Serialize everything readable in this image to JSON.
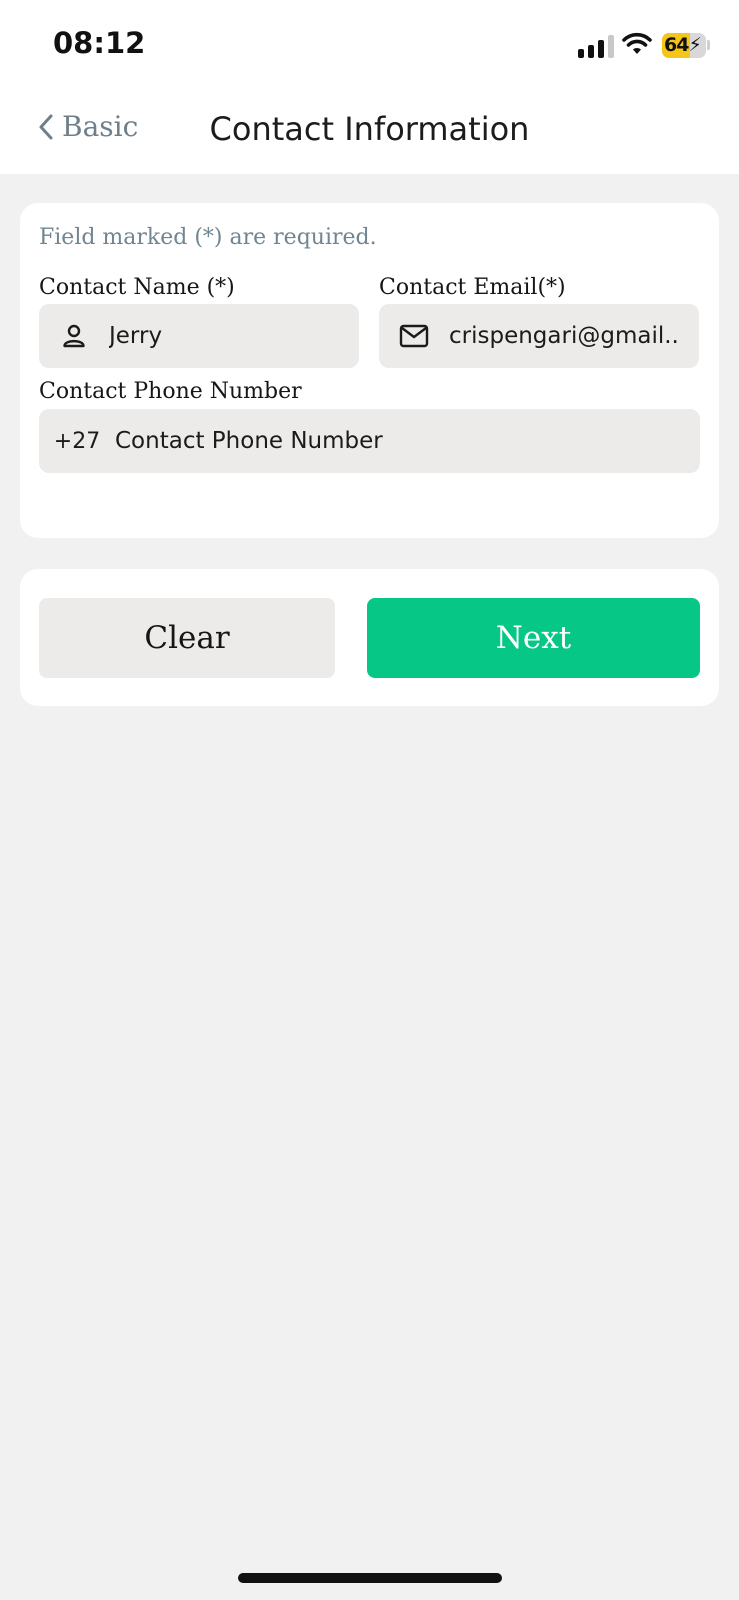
{
  "status_bar": {
    "time": "08:12",
    "battery": "64"
  },
  "nav": {
    "back_label": "Basic",
    "title": "Contact Information"
  },
  "form": {
    "hint": "Field marked (*) are required.",
    "contact_name": {
      "label": "Contact Name (*)",
      "value": "Jerry",
      "icon": "person-icon"
    },
    "contact_email": {
      "label": "Contact Email(*)",
      "value": "crispengari@gmail...",
      "icon": "mail-icon"
    },
    "contact_phone": {
      "label": "Contact Phone Number",
      "country_code": "+27",
      "placeholder": "Contact Phone Number"
    }
  },
  "actions": {
    "clear_label": "Clear",
    "next_label": "Next"
  },
  "colors": {
    "accent": "#06c786",
    "hint_text": "#708592",
    "field_bg": "#ecebea",
    "page_bg": "#f1f1f1"
  }
}
